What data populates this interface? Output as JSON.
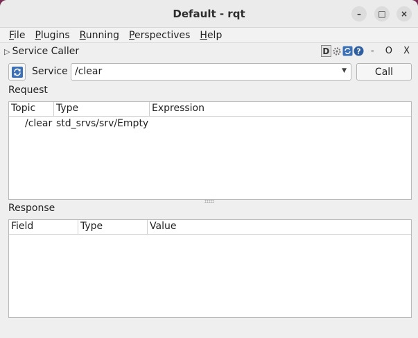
{
  "window": {
    "title": "Default - rqt",
    "controls": {
      "minimize": "–",
      "maximize": "□",
      "close": "×"
    }
  },
  "menubar": {
    "items": [
      {
        "mnemonic": "F",
        "rest": "ile"
      },
      {
        "mnemonic": "P",
        "rest": "lugins"
      },
      {
        "mnemonic": "R",
        "rest": "unning"
      },
      {
        "mnemonic": "P",
        "rest": "erspectives"
      },
      {
        "mnemonic": "H",
        "rest": "elp"
      }
    ]
  },
  "plugin": {
    "title": "Service Caller",
    "d_label": "D",
    "window_controls": "- O X"
  },
  "service": {
    "label": "Service",
    "value": "/clear",
    "call_label": "Call"
  },
  "request": {
    "label": "Request",
    "columns": [
      "Topic",
      "Type",
      "Expression"
    ],
    "rows": [
      {
        "topic": "/clear",
        "type": "std_srvs/srv/Empty",
        "expression": ""
      }
    ]
  },
  "response": {
    "label": "Response",
    "columns": [
      "Field",
      "Type",
      "Value"
    ]
  }
}
